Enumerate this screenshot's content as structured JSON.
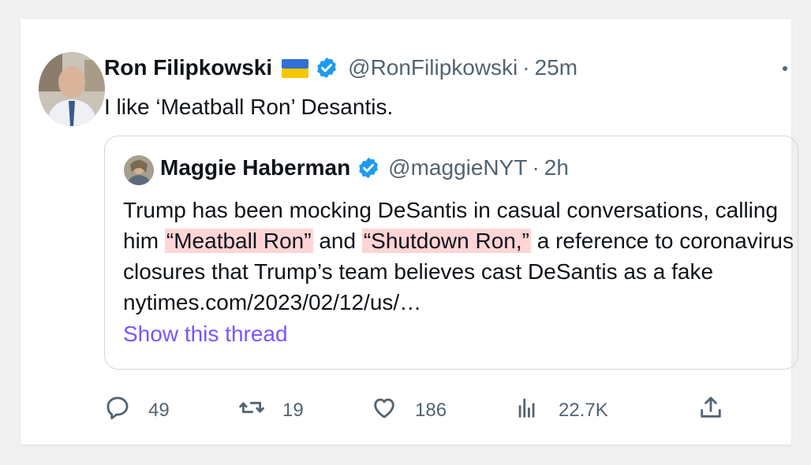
{
  "tweet": {
    "author_name": "Ron Filipkowski",
    "author_flag": "ukraine-flag-icon",
    "verified_icon": "verified-badge-icon",
    "handle": "@RonFilipkowski",
    "separator": "·",
    "time": "25m",
    "text": "I like ‘Meatball Ron’ Desantis."
  },
  "quote": {
    "author_name": "Maggie Haberman",
    "handle": "@maggieNYT",
    "separator": "·",
    "time": "2h",
    "text_part1": "Trump has been mocking DeSantis in casual conversations, calling him ",
    "highlight1": "“Meatball Ron”",
    "text_part2": " and ",
    "highlight2": "“Shutdown Ron,”",
    "text_part3": " a reference to coronavirus closures that Trump’s team believes cast DeSantis as a fake ",
    "link": "nytimes.com/2023/02/12/us/…",
    "show_thread": "Show this thread"
  },
  "actions": {
    "reply_count": "49",
    "retweet_count": "19",
    "like_count": "186",
    "views_count": "22.7K"
  },
  "colors": {
    "accent_link": "#7856ff",
    "verified_blue": "#1d9bf0",
    "highlight": "#ffd5d5",
    "muted": "#536471"
  }
}
